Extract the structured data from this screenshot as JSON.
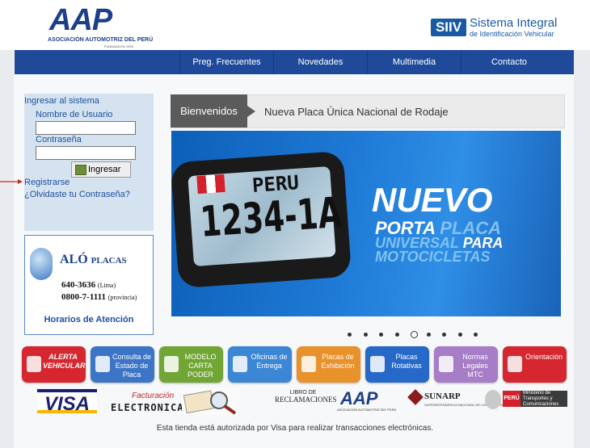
{
  "header": {
    "aap_logo": "AAP",
    "aap_full_name": "ASOCIACIÓN AUTOMOTRIZ DEL PERÚ",
    "aap_tagline": "FUNDADA EN 1926",
    "siiv_abbr": "SIIV",
    "siiv_title": "Sistema Integral",
    "siiv_subtitle": "de Identificación Vehicular"
  },
  "nav": {
    "items": [
      {
        "label": "Preg. Frecuentes"
      },
      {
        "label": "Novedades"
      },
      {
        "label": "Multimedia"
      },
      {
        "label": "Contacto"
      }
    ]
  },
  "login": {
    "title": "Ingresar al sistema",
    "username_label": "Nombre de Usuario",
    "username_value": "",
    "password_label": "Contraseña",
    "password_value": "",
    "submit_label": "Ingresar",
    "register_link": "Registrarse",
    "forgot_link": "¿Olvidaste tu Contraseña?"
  },
  "contact": {
    "title": "ALÓ",
    "title_suffix": "PLACAS",
    "phone_lima": "640-3636",
    "phone_lima_note": "(Lima)",
    "phone_prov": "0800-7-1111",
    "phone_prov_note": "(provincia)",
    "hours_link": "Horarios de Atención"
  },
  "welcome": {
    "tag": "Bienvenidos",
    "headline": "Nueva Placa Única Nacional de Rodaje"
  },
  "banner": {
    "plate_country": "PERU",
    "plate_number": "1234-1A",
    "line1": "NUEVO",
    "line2a": "PORTA ",
    "line2b": "PLACA",
    "line3a": "UNIVERSAL ",
    "line3b": "PARA",
    "line4": "MOTOCICLETAS"
  },
  "carousel": {
    "slide_count": 9,
    "active_index": 4
  },
  "tiles": [
    {
      "label": "ALERTA VEHICULAR",
      "color": "#d6262f"
    },
    {
      "label": "Consulta de Estado de Placa",
      "color": "#3c74c6"
    },
    {
      "label": "MODELO CARTA PODER",
      "color": "#71a534"
    },
    {
      "label": "Oficinas de Entrega",
      "color": "#3c86d6"
    },
    {
      "label": "Placas de Exhibición",
      "color": "#e9912a"
    },
    {
      "label": "Placas Rotativas",
      "color": "#2669c9"
    },
    {
      "label": "Normas Legales MTC",
      "color": "#a77dc8"
    },
    {
      "label": "Orientación",
      "color": "#d6262f"
    }
  ],
  "tile_texts": {
    "exhibicion_plate": "PLACA DE EXHIBICIÓN",
    "rotativa_plate": "RM-123",
    "rotativa_country": "PERU"
  },
  "partners": {
    "visa": "VISA",
    "facturacion_top": "Facturación",
    "facturacion_bottom": "ELECTRONICA",
    "libro_top": "LIBRO DE",
    "libro_bottom": "RECLAMACIONES",
    "aap": "AAP",
    "aap_sub": "ASOCIACIÓN AUTOMOTRIZ DEL PERÚ",
    "sunarp": "SUNARP",
    "sunarp_sub": "SUPERINTENDENCIA NACIONAL DE LOS REGISTROS PÚBLICOS",
    "mtc_country": "PERÚ",
    "mtc_ministry": "Ministerio de Transportes y Comunicaciones"
  },
  "footer": {
    "text": "Esta tienda está autorizada por Visa para realizar transacciones electrónicas."
  }
}
